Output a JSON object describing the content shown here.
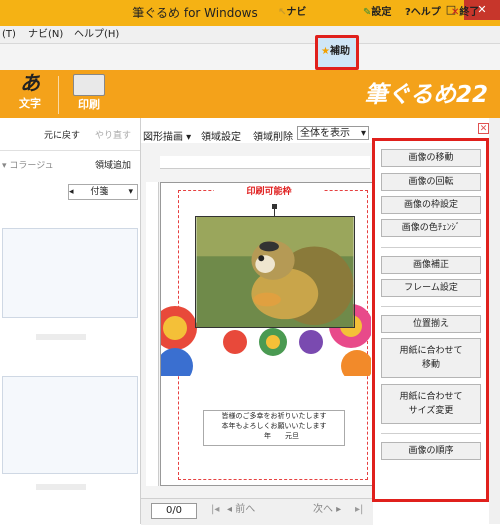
{
  "window": {
    "title": "筆ぐるめ for Windows",
    "minimize": "–",
    "maximize": "□",
    "close": "✕"
  },
  "menubar": {
    "items": [
      "(T)",
      "ナビ(N)",
      "ヘルプ(H)"
    ]
  },
  "toolbar": {
    "navi": "ナビ",
    "hojo": "補助",
    "settings": "設定",
    "help": "?ヘルプ",
    "exit": "終了"
  },
  "band": {
    "moji": "文字",
    "insatsu": "印刷",
    "moji_glyph": "あ",
    "logo": "筆ぐるめ22"
  },
  "left_panel": {
    "undo": "元に戻す",
    "redo": "やり直す",
    "collage": "コラージュ",
    "add_area": "領域追加",
    "dropdown": "付箋"
  },
  "center": {
    "figure_draw": "図形描画",
    "area_settings": "領域設定",
    "area_delete": "領域削除",
    "zoom_select": "全体を表示",
    "print_area_label": "印刷可能枠",
    "greeting_line1": "皆様のご多幸をお祈りいたします",
    "greeting_line2": "本年もよろしくお願いいたします",
    "greeting_line3": "年　　元旦",
    "page_counter": "0/0",
    "prev": "前へ",
    "next": "次へ"
  },
  "right_panel": {
    "buttons": [
      "画像の移動",
      "画像の回転",
      "画像の枠設定",
      "画像の色ﾁｪﾝｼﾞ",
      "画像補正",
      "フレーム設定",
      "位置揃え",
      "用紙に合わせて\n移動",
      "用紙に合わせて\nサイズ変更",
      "画像の順序"
    ]
  },
  "colors": {
    "accent": "#f4a21a",
    "highlight": "#e0201c",
    "title_bar": "#f5b214"
  }
}
